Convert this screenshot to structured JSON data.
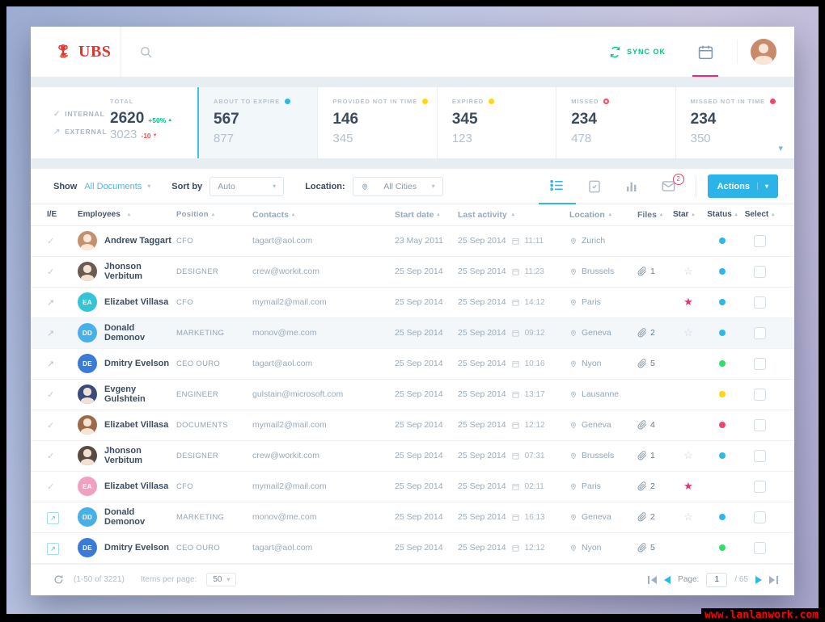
{
  "watermark": "www.lanlanwork.com",
  "header": {
    "logo_text": "UBS",
    "sync_label": "SYNC OK"
  },
  "stats": {
    "internal_label": "INTERNAL",
    "external_label": "EXTERNAL",
    "total_label": "TOTAL",
    "total_internal": "2620",
    "total_internal_delta": "+50%",
    "total_external": "3023",
    "total_external_delta": "-10",
    "cards": [
      {
        "label": "ABOUT TO EXPIRE",
        "dot_color": "#2db8e8",
        "dot_style": "filled",
        "internal": "567",
        "external": "877",
        "active": true
      },
      {
        "label": "PROVIDED NOT IN TIME",
        "dot_color": "#ffd613",
        "dot_style": "filled",
        "internal": "146",
        "external": "345",
        "active": false
      },
      {
        "label": "EXPIRED",
        "dot_color": "#ffd613",
        "dot_style": "filled",
        "internal": "345",
        "external": "123",
        "active": false
      },
      {
        "label": "MISSED",
        "dot_color": "#ff4757",
        "dot_style": "outline",
        "internal": "234",
        "external": "478",
        "active": false
      },
      {
        "label": "MISSED NOT IN TIME",
        "dot_color": "#f0486c",
        "dot_style": "filled",
        "internal": "234",
        "external": "350",
        "active": false
      }
    ]
  },
  "toolbar": {
    "show_label": "Show",
    "show_value": "All Documents",
    "sort_label": "Sort by",
    "sort_value": "Auto",
    "location_label": "Location:",
    "location_value": "All Cities",
    "mail_badge": "2",
    "actions_label": "Actions"
  },
  "table": {
    "columns": [
      {
        "label": "I/E",
        "sortable": false
      },
      {
        "label": "Employees",
        "sortable": true
      },
      {
        "label": "Position",
        "sortable": true
      },
      {
        "label": "Contacts",
        "sortable": true
      },
      {
        "label": "Start date",
        "sortable": true
      },
      {
        "label": "Last activity",
        "sortable": true
      },
      {
        "label": "Location",
        "sortable": true
      },
      {
        "label": "Files",
        "sortable": true
      },
      {
        "label": "Star",
        "sortable": true
      },
      {
        "label": "Status",
        "sortable": true
      },
      {
        "label": "Select",
        "sortable": true
      }
    ],
    "rows": [
      {
        "ie": "internal",
        "avatar": {
          "type": "photo",
          "color": "#c4916f",
          "initials": ""
        },
        "name": "Andrew Taggart",
        "position": "CFO",
        "contact": "tagart@aol.com",
        "start_date": "23 May 2011",
        "activity_date": "25 Sep 2014",
        "activity_time": "11:11",
        "location": "Zurich",
        "files": "",
        "star": "none",
        "status_color": "#2db8e8",
        "highlighted": false
      },
      {
        "ie": "internal",
        "avatar": {
          "type": "photo",
          "color": "#6b5a50",
          "initials": ""
        },
        "name": "Jhonson Verbitum",
        "position": "DESIGNER",
        "contact": "crew@workit.com",
        "start_date": "25 Sep 2014",
        "activity_date": "25 Sep 2014",
        "activity_time": "11:23",
        "location": "Brussels",
        "files": "1",
        "star": "outline",
        "status_color": "#2db8e8",
        "highlighted": false
      },
      {
        "ie": "external",
        "avatar": {
          "type": "initials",
          "color": "#35c4d7",
          "initials": "EA"
        },
        "name": "Elizabet Villasa",
        "position": "CFO",
        "contact": "mymail2@mail.com",
        "start_date": "25 Sep 2014",
        "activity_date": "25 Sep 2014",
        "activity_time": "14:12",
        "location": "Paris",
        "files": "",
        "star": "filled",
        "status_color": "#2db8e8",
        "highlighted": false
      },
      {
        "ie": "external",
        "avatar": {
          "type": "initials",
          "color": "#47b0e8",
          "initials": "DD"
        },
        "name": "Donald Demonov",
        "position": "MARKETING",
        "contact": "monov@me.com",
        "start_date": "25 Sep 2014",
        "activity_date": "25 Sep 2014",
        "activity_time": "09:12",
        "location": "Geneva",
        "files": "2",
        "star": "outline",
        "status_color": "#2db8e8",
        "highlighted": true
      },
      {
        "ie": "external",
        "avatar": {
          "type": "initials",
          "color": "#3a7bd5",
          "initials": "DE"
        },
        "name": "Dmitry Evelson",
        "position": "CEO OURO",
        "contact": "tagart@aol.com",
        "start_date": "25 Sep 2014",
        "activity_date": "25 Sep 2014",
        "activity_time": "10:16",
        "location": "Nyon",
        "files": "5",
        "star": "none",
        "status_color": "#2ee06a",
        "highlighted": false
      },
      {
        "ie": "internal",
        "avatar": {
          "type": "photo",
          "color": "#3a4a7a",
          "initials": ""
        },
        "name": "Evgeny Gulshtein",
        "position": "ENGINEER",
        "contact": "gulstain@microsoft.com",
        "start_date": "25 Sep 2014",
        "activity_date": "25 Sep 2014",
        "activity_time": "13:17",
        "location": "Lausanne",
        "files": "",
        "star": "none",
        "status_color": "#ffd613",
        "highlighted": false
      },
      {
        "ie": "internal",
        "avatar": {
          "type": "photo",
          "color": "#9a6a4a",
          "initials": ""
        },
        "name": "Elizabet Villasa",
        "position": "DOCUMENTS",
        "contact": "mymail2@mail.com",
        "start_date": "25 Sep 2014",
        "activity_date": "25 Sep 2014",
        "activity_time": "12:12",
        "location": "Geneva",
        "files": "4",
        "star": "none",
        "status_color": "#f0486c",
        "highlighted": false
      },
      {
        "ie": "internal",
        "avatar": {
          "type": "photo",
          "color": "#5a4a42",
          "initials": ""
        },
        "name": "Jhonson Verbitum",
        "position": "DESIGNER",
        "contact": "crew@workit.com",
        "start_date": "25 Sep 2014",
        "activity_date": "25 Sep 2014",
        "activity_time": "07:31",
        "location": "Brussels",
        "files": "1",
        "star": "outline",
        "status_color": "#2db8e8",
        "highlighted": false
      },
      {
        "ie": "internal",
        "avatar": {
          "type": "initials",
          "color": "#f2a0c0",
          "initials": "EA"
        },
        "name": "Elizabet Villasa",
        "position": "CFO",
        "contact": "mymail2@mail.com",
        "start_date": "25 Sep 2014",
        "activity_date": "25 Sep 2014",
        "activity_time": "02:11",
        "location": "Paris",
        "files": "2",
        "star": "filled",
        "status_color": "",
        "highlighted": false
      },
      {
        "ie": "external-link",
        "avatar": {
          "type": "initials",
          "color": "#47b0e8",
          "initials": "DD"
        },
        "name": "Donald Demonov",
        "position": "MARKETING",
        "contact": "monov@me.com",
        "start_date": "25 Sep 2014",
        "activity_date": "25 Sep 2014",
        "activity_time": "16:13",
        "location": "Geneva",
        "files": "2",
        "star": "outline",
        "status_color": "#2db8e8",
        "highlighted": false
      },
      {
        "ie": "external-link",
        "avatar": {
          "type": "initials",
          "color": "#3a7bd5",
          "initials": "DE"
        },
        "name": "Dmitry Evelson",
        "position": "CEO OURO",
        "contact": "tagart@aol.com",
        "start_date": "25 Sep 2014",
        "activity_date": "25 Sep 2014",
        "activity_time": "12:12",
        "location": "Nyon",
        "files": "5",
        "star": "none",
        "status_color": "#2ee06a",
        "highlighted": false
      }
    ]
  },
  "pagination": {
    "range_text": "(1-50 of 3221)",
    "per_page_label": "Items per page:",
    "per_page_value": "50",
    "page_label": "Page:",
    "page_value": "1",
    "total_text": "/ 65"
  }
}
